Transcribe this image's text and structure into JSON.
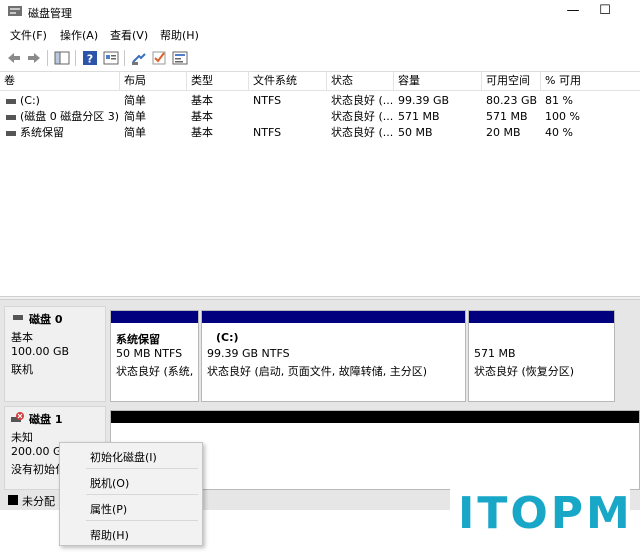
{
  "window": {
    "title": "磁盘管理",
    "minimize": "—",
    "maximize": "☐"
  },
  "menu": [
    "文件(F)",
    "操作(A)",
    "查看(V)",
    "帮助(H)"
  ],
  "toolbar": [
    "back-arrow-icon",
    "forward-arrow-icon",
    "console-tree-icon",
    "help-icon",
    "properties-icon",
    "connect-icon",
    "check-icon",
    "settings-icon"
  ],
  "volume_list": {
    "headers": [
      "卷",
      "布局",
      "类型",
      "文件系统",
      "状态",
      "容量",
      "可用空间",
      "% 可用"
    ],
    "rows": [
      [
        "(C:)",
        "简单",
        "基本",
        "NTFS",
        "状态良好 (...",
        "99.39 GB",
        "80.23 GB",
        "81 %"
      ],
      [
        "(磁盘 0 磁盘分区 3)",
        "简单",
        "基本",
        "",
        "状态良好 (...",
        "571 MB",
        "571 MB",
        "100 %"
      ],
      [
        "系统保留",
        "简单",
        "基本",
        "NTFS",
        "状态良好 (...",
        "50 MB",
        "20 MB",
        "40 %"
      ]
    ]
  },
  "disks": [
    {
      "name": "磁盘 0",
      "type": "基本",
      "size": "100.00 GB",
      "status": "联机",
      "partitions": [
        {
          "name": "系统保留",
          "size": "50 MB NTFS",
          "status": "状态良好 (系统,"
        },
        {
          "name": "(C:)",
          "size": "99.39 GB NTFS",
          "status": "状态良好 (启动, 页面文件, 故障转储, 主分区)"
        },
        {
          "name": "",
          "size": "571 MB",
          "status": "状态良好 (恢复分区)"
        }
      ]
    },
    {
      "name": "磁盘 1",
      "type": "未知",
      "size": "200.00 G",
      "status": "没有初始化"
    }
  ],
  "legend": {
    "unallocated": "未分配"
  },
  "context_menu": [
    "初始化磁盘(I)",
    "脱机(O)",
    "属性(P)",
    "帮助(H)"
  ],
  "watermark": "ITOPM",
  "colors": {
    "partition_bar": "#00007f",
    "unknown_bar": "#000000",
    "logo": "#19a7c8",
    "disk_error": "#d43a3a"
  }
}
